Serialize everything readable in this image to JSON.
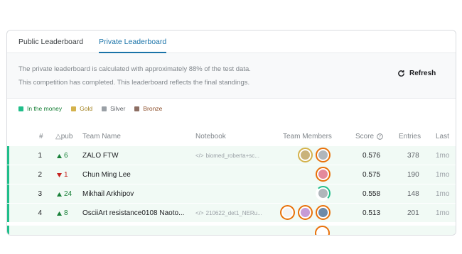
{
  "tabs": [
    {
      "label": "Public Leaderboard",
      "active": false
    },
    {
      "label": "Private Leaderboard",
      "active": true
    }
  ],
  "info": {
    "line1": "The private leaderboard is calculated with approximately 88% of the test data.",
    "line2": "This competition has completed. This leaderboard reflects the final standings.",
    "refresh_label": "Refresh"
  },
  "legend": [
    {
      "label": "In the money",
      "color": "#20be8a"
    },
    {
      "label": "Gold",
      "color": "#d4b24c"
    },
    {
      "label": "Silver",
      "color": "#9aa0a6"
    },
    {
      "label": "Bronze",
      "color": "#8d6e63"
    }
  ],
  "columns": {
    "rank": "#",
    "delta": "△pub",
    "team": "Team Name",
    "notebook": "Notebook",
    "members": "Team Members",
    "score": "Score",
    "entries": "Entries",
    "last": "Last"
  },
  "rows": [
    {
      "rank": "1",
      "delta": "6",
      "direction": "up",
      "team": "ZALO FTW",
      "notebook": "biomed_roberta+sc...",
      "score": "0.576",
      "entries": "378",
      "last": "1mo"
    },
    {
      "rank": "2",
      "delta": "1",
      "direction": "down",
      "team": "Chun Ming Lee",
      "notebook": "",
      "score": "0.575",
      "entries": "190",
      "last": "1mo"
    },
    {
      "rank": "3",
      "delta": "24",
      "direction": "up",
      "team": "Mikhail Arkhipov",
      "notebook": "",
      "score": "0.558",
      "entries": "148",
      "last": "1mo"
    },
    {
      "rank": "4",
      "delta": "8",
      "direction": "up",
      "team": "OsciiArt resistance0108 Naoto...",
      "notebook": "210622_det1_NERu...",
      "score": "0.513",
      "entries": "201",
      "last": "1mo"
    }
  ]
}
